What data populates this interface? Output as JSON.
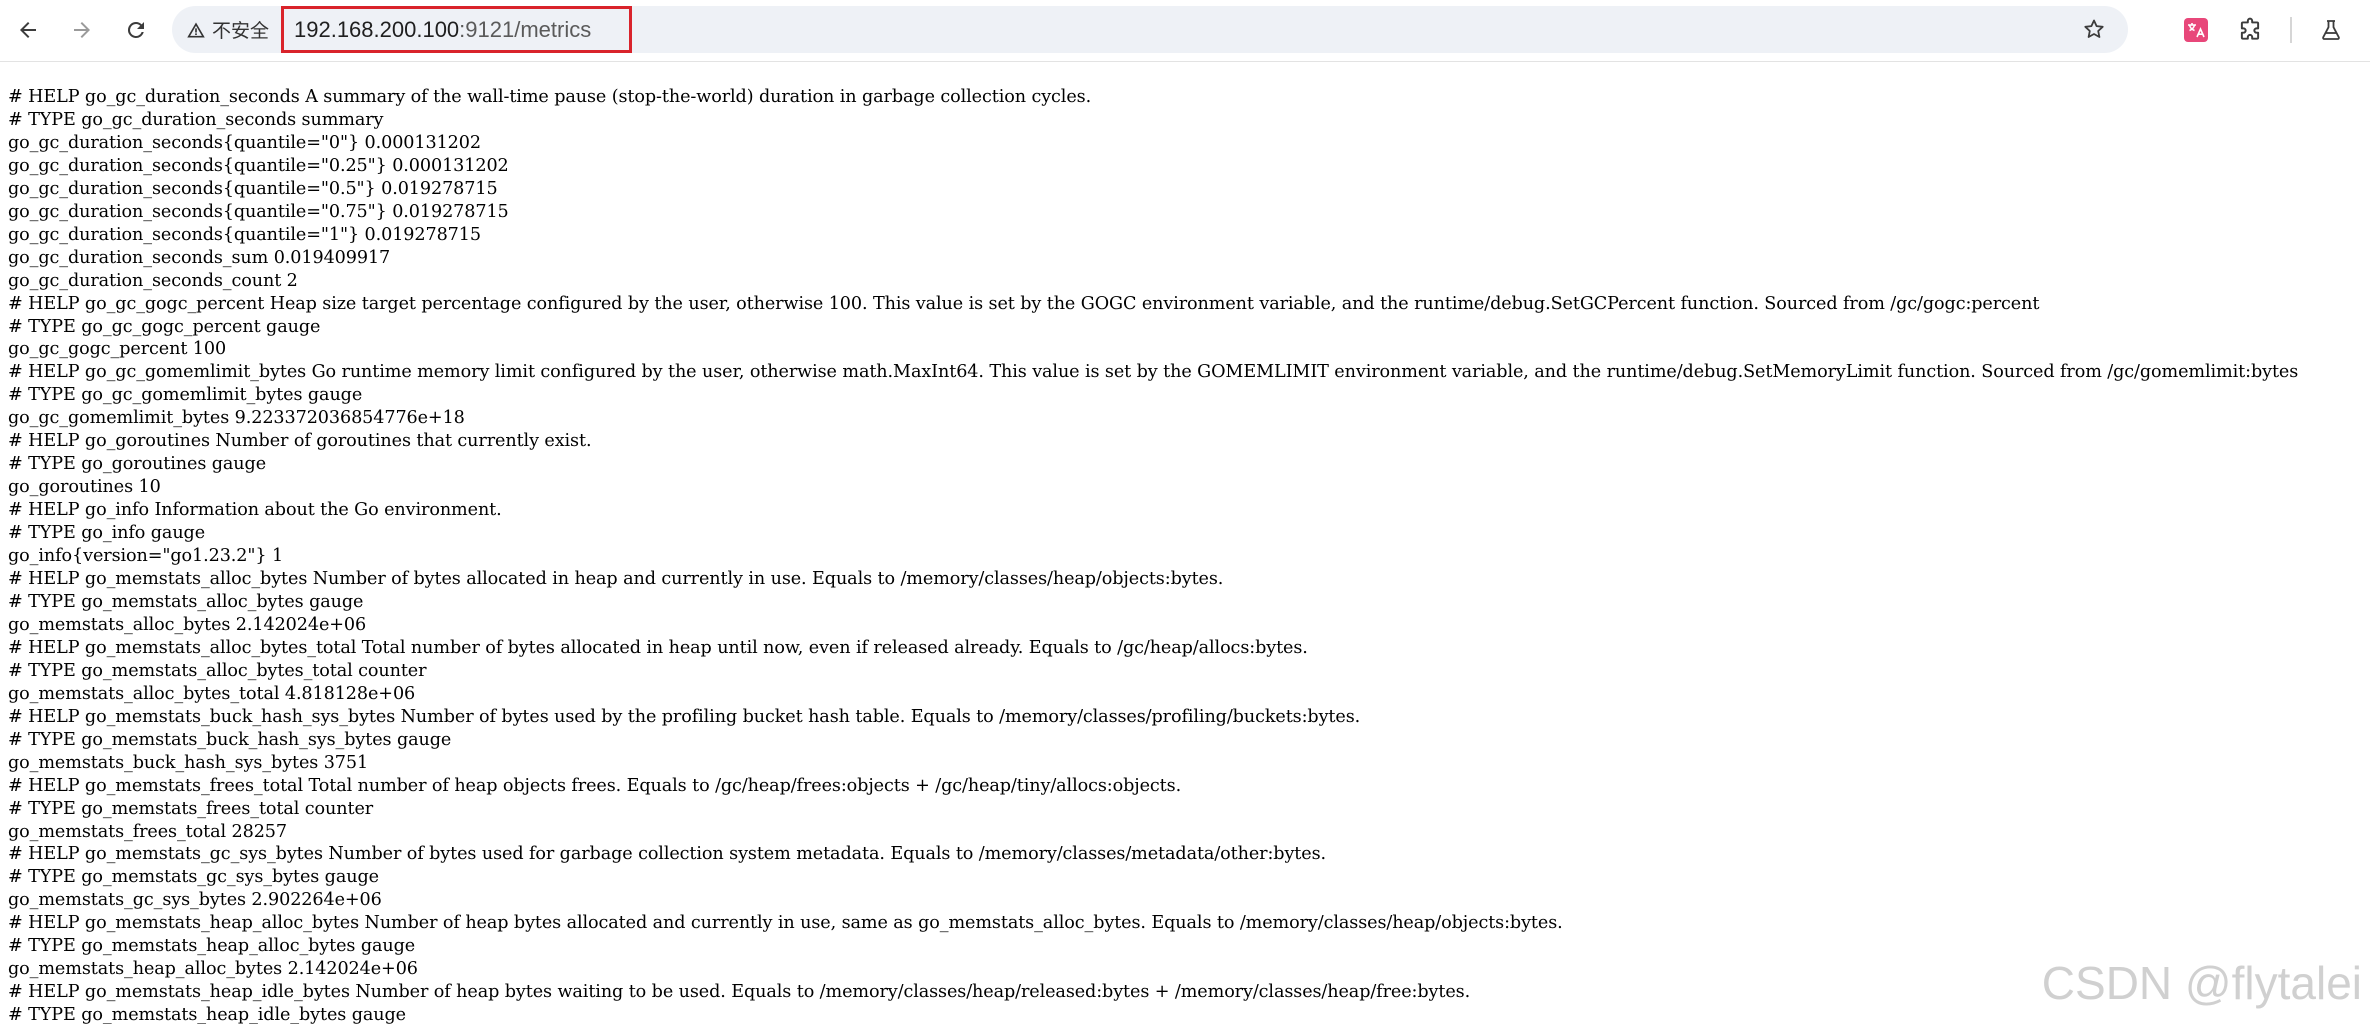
{
  "browser": {
    "security_label": "不安全",
    "url_host": "192.168.200.100",
    "url_path": ":9121/metrics",
    "icons": {
      "back": "arrow-left-icon",
      "forward": "arrow-right-icon",
      "reload": "reload-icon",
      "warning": "warning-triangle-icon",
      "bookmark": "star-icon",
      "translate": "translate-icon",
      "extensions": "puzzle-icon",
      "labs": "flask-icon"
    },
    "colors": {
      "highlight_border": "#d9232b",
      "translate_badge": "#e8477a"
    }
  },
  "metrics_lines": [
    "# HELP go_gc_duration_seconds A summary of the wall-time pause (stop-the-world) duration in garbage collection cycles.",
    "# TYPE go_gc_duration_seconds summary",
    "go_gc_duration_seconds{quantile=\"0\"} 0.000131202",
    "go_gc_duration_seconds{quantile=\"0.25\"} 0.000131202",
    "go_gc_duration_seconds{quantile=\"0.5\"} 0.019278715",
    "go_gc_duration_seconds{quantile=\"0.75\"} 0.019278715",
    "go_gc_duration_seconds{quantile=\"1\"} 0.019278715",
    "go_gc_duration_seconds_sum 0.019409917",
    "go_gc_duration_seconds_count 2",
    "# HELP go_gc_gogc_percent Heap size target percentage configured by the user, otherwise 100. This value is set by the GOGC environment variable, and the runtime/debug.SetGCPercent function. Sourced from /gc/gogc:percent",
    "# TYPE go_gc_gogc_percent gauge",
    "go_gc_gogc_percent 100",
    "# HELP go_gc_gomemlimit_bytes Go runtime memory limit configured by the user, otherwise math.MaxInt64. This value is set by the GOMEMLIMIT environment variable, and the runtime/debug.SetMemoryLimit function. Sourced from /gc/gomemlimit:bytes",
    "# TYPE go_gc_gomemlimit_bytes gauge",
    "go_gc_gomemlimit_bytes 9.223372036854776e+18",
    "# HELP go_goroutines Number of goroutines that currently exist.",
    "# TYPE go_goroutines gauge",
    "go_goroutines 10",
    "# HELP go_info Information about the Go environment.",
    "# TYPE go_info gauge",
    "go_info{version=\"go1.23.2\"} 1",
    "# HELP go_memstats_alloc_bytes Number of bytes allocated in heap and currently in use. Equals to /memory/classes/heap/objects:bytes.",
    "# TYPE go_memstats_alloc_bytes gauge",
    "go_memstats_alloc_bytes 2.142024e+06",
    "# HELP go_memstats_alloc_bytes_total Total number of bytes allocated in heap until now, even if released already. Equals to /gc/heap/allocs:bytes.",
    "# TYPE go_memstats_alloc_bytes_total counter",
    "go_memstats_alloc_bytes_total 4.818128e+06",
    "# HELP go_memstats_buck_hash_sys_bytes Number of bytes used by the profiling bucket hash table. Equals to /memory/classes/profiling/buckets:bytes.",
    "# TYPE go_memstats_buck_hash_sys_bytes gauge",
    "go_memstats_buck_hash_sys_bytes 3751",
    "# HELP go_memstats_frees_total Total number of heap objects frees. Equals to /gc/heap/frees:objects + /gc/heap/tiny/allocs:objects.",
    "# TYPE go_memstats_frees_total counter",
    "go_memstats_frees_total 28257",
    "# HELP go_memstats_gc_sys_bytes Number of bytes used for garbage collection system metadata. Equals to /memory/classes/metadata/other:bytes.",
    "# TYPE go_memstats_gc_sys_bytes gauge",
    "go_memstats_gc_sys_bytes 2.902264e+06",
    "# HELP go_memstats_heap_alloc_bytes Number of heap bytes allocated and currently in use, same as go_memstats_alloc_bytes. Equals to /memory/classes/heap/objects:bytes.",
    "# TYPE go_memstats_heap_alloc_bytes gauge",
    "go_memstats_heap_alloc_bytes 2.142024e+06",
    "# HELP go_memstats_heap_idle_bytes Number of heap bytes waiting to be used. Equals to /memory/classes/heap/released:bytes + /memory/classes/heap/free:bytes.",
    "# TYPE go_memstats_heap_idle_bytes gauge"
  ],
  "watermark": "CSDN @flytalei"
}
